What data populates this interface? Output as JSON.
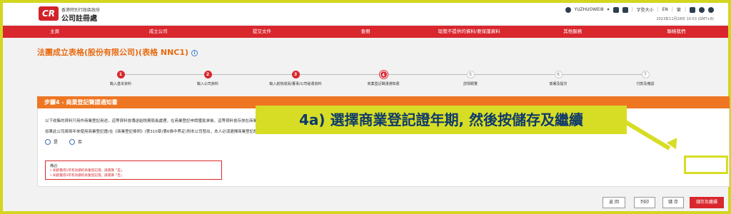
{
  "header": {
    "logo_text": "CR",
    "logo_sub": "香港特別行政區政府",
    "logo_main": "公司註冊處",
    "user": "YUZHUOWEI8",
    "font_size_label": "字型大小",
    "lang_en": "EN",
    "lang_tc": "繁",
    "datetime": "2023年11月28日 10:53 (GMT+8)"
  },
  "nav": {
    "items": [
      "主頁",
      "成立公司",
      "提交文件",
      "查冊",
      "取覽不提供的資料/要保護資料",
      "其他服務",
      "聯絡我們"
    ]
  },
  "page": {
    "title": "法團成立表格(股份有限公司)(表格 NNC1)",
    "info_icon_text": "i"
  },
  "stepper": {
    "steps": [
      {
        "num": "1",
        "label": "輸入基本資料",
        "state": "done"
      },
      {
        "num": "2",
        "label": "輸入公司資料",
        "state": "done"
      },
      {
        "num": "3",
        "label": "輸入創辦成員/董事/公司秘書資料",
        "state": "done"
      },
      {
        "num": "4",
        "label": "商業登記聲請通知書",
        "state": "current"
      },
      {
        "num": "5",
        "label": "詳情概覽",
        "state": "pending"
      },
      {
        "num": "6",
        "label": "簽署及提交",
        "state": "pending"
      },
      {
        "num": "7",
        "label": "付款及確認",
        "state": "pending"
      }
    ]
  },
  "section": {
    "heading": "步驟4 - 商業登記聲請通知書",
    "para1": "以下收集的資料只用作商業登記用途，這等資料會傳送給稅務局長處理，在商業登記申請獲批准後，這等資料會存放在商業登記冊上，供公眾查閱，但不會存放在公司註冊處的登記冊上。",
    "para2": "如果此公司將兩年來使用商業登記證(在《商業登記條例》(第310章)第6條中界定)附本公司發出，本人必須選擇商業登記證內所註明的屆滿日期內為自其內所註明的生效日期起計的3 年屆滿之日。",
    "radio_yes": "是",
    "radio_no": "否",
    "remarks_title": "備註:",
    "remarks": [
      "• 如欲獲得1年有效期的商業登記證，請選擇「是」",
      "• 如欲獲得3年有效期的商業登記證，請選擇「否」"
    ]
  },
  "callout": "4a) 選擇商業登記證年期, 然後按儲存及繼續",
  "actions": {
    "back": "返 回",
    "print": "列印",
    "save": "儲 存",
    "save_continue": "儲存及繼續"
  },
  "colors": {
    "brand_red": "#d9272e",
    "orange": "#ee7623",
    "highlight": "#d7dd25"
  }
}
